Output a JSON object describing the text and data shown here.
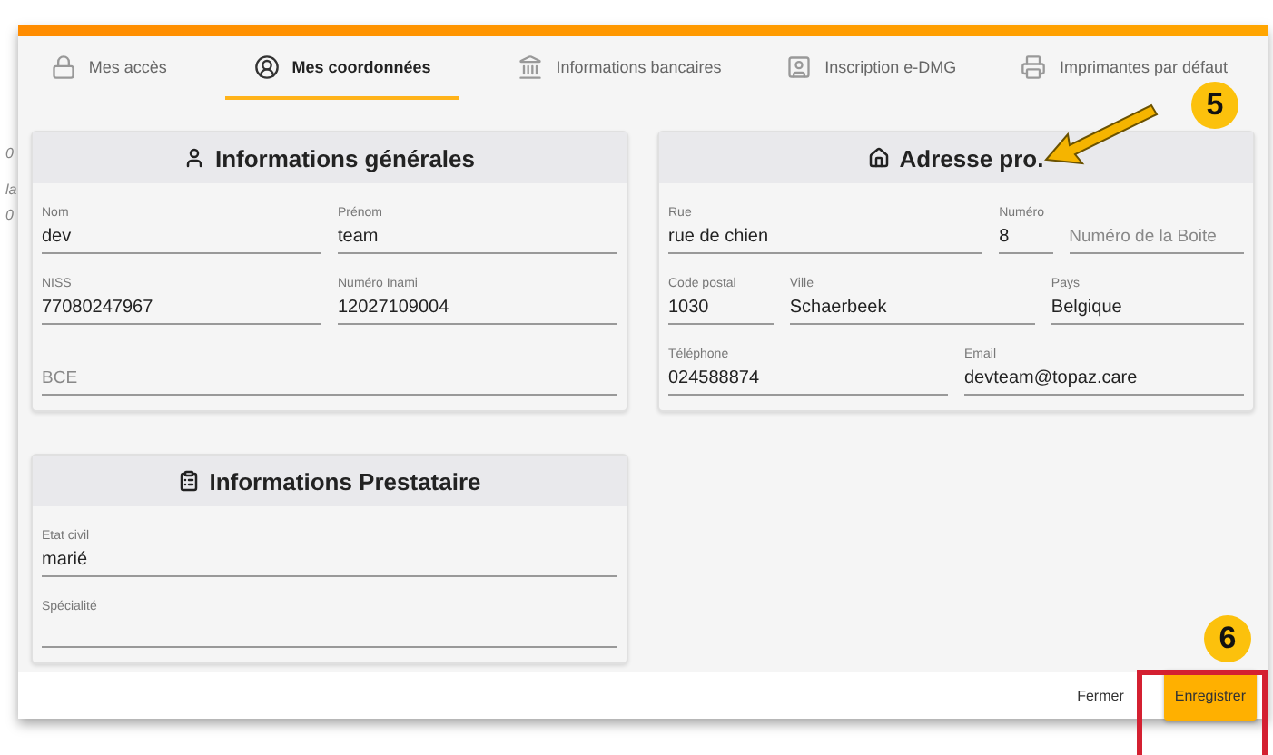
{
  "backdrop_fragments": [
    "0",
    "la",
    "0"
  ],
  "tabs": [
    {
      "label": "Mes accès",
      "selected": false
    },
    {
      "label": "Mes coordonnées",
      "selected": true
    },
    {
      "label": "Informations bancaires",
      "selected": false
    },
    {
      "label": "Inscription e-DMG",
      "selected": false
    },
    {
      "label": "Imprimantes par défaut",
      "selected": false
    }
  ],
  "cards": [
    {
      "title": "Informations générales",
      "fields": [
        {
          "label": "Nom",
          "value": "dev"
        },
        {
          "label": "Prénom",
          "value": "team"
        },
        {
          "label": "NISS",
          "value": "77080247967"
        },
        {
          "label": "Numéro Inami",
          "value": "12027109004"
        },
        {
          "placeholder": "BCE"
        }
      ]
    },
    {
      "title": "Adresse pro.",
      "fields": [
        {
          "label": "Rue",
          "value": "rue de chien"
        },
        {
          "label": "Numéro",
          "value": "8"
        },
        {
          "placeholder": "Numéro de la Boite"
        },
        {
          "label": "Code postal",
          "value": "1030"
        },
        {
          "label": "Ville",
          "value": "Schaerbeek"
        },
        {
          "label": "Pays",
          "value": "Belgique"
        },
        {
          "label": "Téléphone",
          "value": "024588874"
        },
        {
          "label": "Email",
          "value": "devteam@topaz.care"
        }
      ]
    },
    {
      "title": "Informations Prestataire",
      "fields": [
        {
          "label": "Etat civil",
          "value": "marié"
        },
        {
          "label": "Spécialité"
        }
      ]
    }
  ],
  "footer": {
    "cancel": "Fermer",
    "save": "Enregistrer"
  },
  "annotations": [
    {
      "number": "5"
    },
    {
      "number": "6"
    }
  ]
}
